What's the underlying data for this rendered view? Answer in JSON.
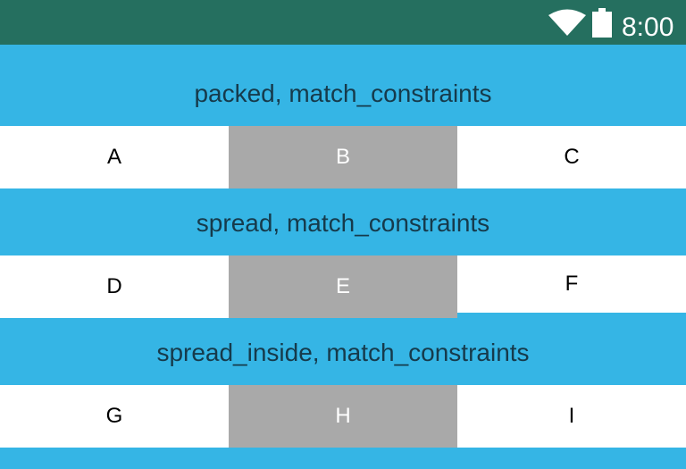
{
  "status_bar": {
    "time": "8:00",
    "icons": [
      "wifi-icon",
      "battery-icon"
    ],
    "background": "#256f5f"
  },
  "colors": {
    "header_bg": "#35b5e5",
    "cell_white": "#ffffff",
    "cell_grey": "#a9a9a9",
    "title_text": "#163a4b"
  },
  "sections": [
    {
      "title": "packed, match_constraints",
      "cells": [
        "A",
        "B",
        "C"
      ]
    },
    {
      "title": "spread, match_constraints",
      "cells": [
        "D",
        "E",
        "F"
      ]
    },
    {
      "title": "spread_inside, match_constraints",
      "cells": [
        "G",
        "H",
        "I"
      ]
    }
  ]
}
